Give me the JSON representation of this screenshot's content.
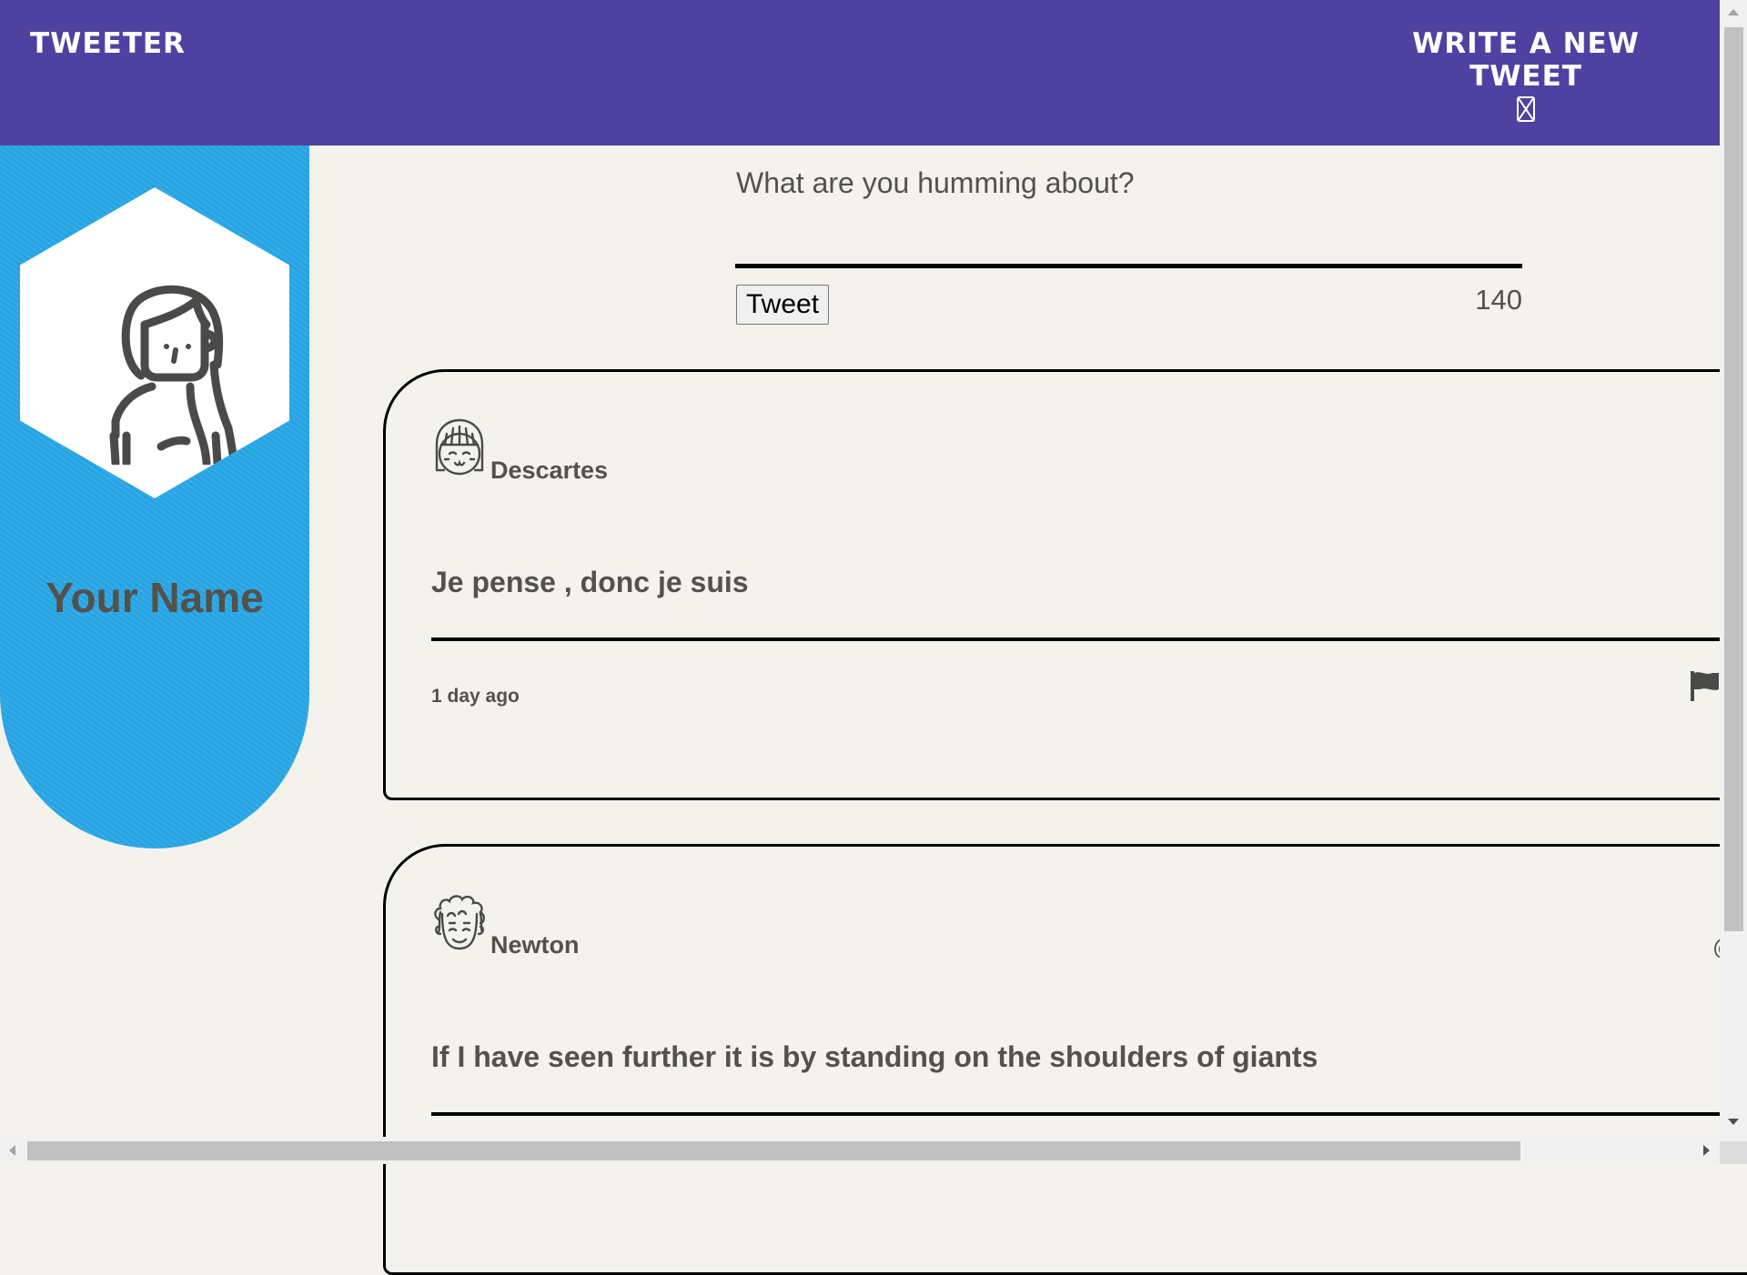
{
  "header": {
    "brand": "Tweeter",
    "compose_toggle_label": "Write a new tweet",
    "compose_icon": "collapse-icon"
  },
  "profile": {
    "name": "Your Name",
    "avatar_icon": "female-avatar-icon"
  },
  "compose": {
    "placeholder": "What are you humming about?",
    "value": "",
    "submit_label": "Tweet",
    "char_count": "140"
  },
  "tweets": [
    {
      "author": "Descartes",
      "avatar_icon": "girl-avatar-icon",
      "text": "Je pense , donc je suis",
      "time": "1 day ago",
      "action_icon": "flag-icon"
    },
    {
      "author": "Newton",
      "avatar_icon": "curly-hair-avatar-icon",
      "handle_glyph": "@",
      "text": "If I have seen further it is by standing on the shoulders of giants"
    }
  ],
  "colors": {
    "header_bg": "#4f41a0",
    "profile_bg": "#29a8e8",
    "page_bg": "#f4f2ed",
    "text": "#545149"
  }
}
